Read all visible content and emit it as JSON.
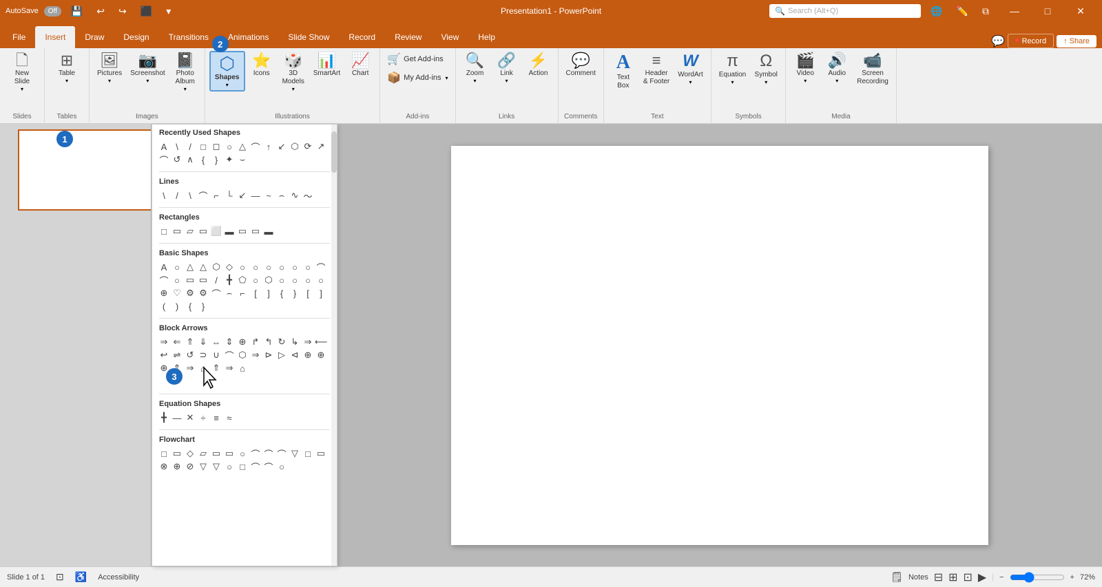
{
  "titleBar": {
    "autosave": "AutoSave",
    "toggleState": "Off",
    "title": "Presentation1 - PowerPoint",
    "searchPlaceholder": "Search (Alt+Q)"
  },
  "tabs": {
    "items": [
      "File",
      "Insert",
      "Draw",
      "Design",
      "Transitions",
      "Animations",
      "Slide Show",
      "Record",
      "Review",
      "View",
      "Help"
    ],
    "activeTab": "Insert"
  },
  "ribbonGroups": {
    "slides": {
      "label": "Slides",
      "items": [
        {
          "label": "New\nSlide",
          "icon": "🗋"
        }
      ]
    },
    "tables": {
      "label": "Tables",
      "items": [
        {
          "label": "Table",
          "icon": "⊞"
        }
      ]
    },
    "images": {
      "label": "Images",
      "items": [
        {
          "label": "Pictures",
          "icon": "🖼"
        },
        {
          "label": "Screenshot",
          "icon": "📷"
        },
        {
          "label": "Photo\nAlbum",
          "icon": "📓"
        }
      ]
    },
    "illustrations": {
      "label": "Illustrations",
      "items": [
        {
          "label": "Shapes",
          "icon": "⬡",
          "active": true
        },
        {
          "label": "Icons",
          "icon": "⭐"
        },
        {
          "label": "3D\nModels",
          "icon": "🎲"
        },
        {
          "label": "SmartArt",
          "icon": "📊"
        },
        {
          "label": "Chart",
          "icon": "📈"
        }
      ]
    },
    "addins": {
      "label": "Add-ins",
      "items": [
        {
          "label": "Get Add-ins",
          "icon": "🛒"
        },
        {
          "label": "My Add-ins",
          "icon": "📦"
        }
      ]
    },
    "links": {
      "label": "Links",
      "items": [
        {
          "label": "Zoom",
          "icon": "🔍"
        },
        {
          "label": "Link",
          "icon": "🔗"
        },
        {
          "label": "Action",
          "icon": "⚡"
        }
      ]
    },
    "comments": {
      "label": "Comments",
      "items": [
        {
          "label": "Comment",
          "icon": "💬"
        }
      ]
    },
    "text": {
      "label": "Text",
      "items": [
        {
          "label": "Text\nBox",
          "icon": "A"
        },
        {
          "label": "Header\n& Footer",
          "icon": "≡"
        },
        {
          "label": "WordArt",
          "icon": "W"
        }
      ]
    },
    "symbols": {
      "label": "Symbols",
      "items": [
        {
          "label": "Equation",
          "icon": "π"
        },
        {
          "label": "Symbol",
          "icon": "Ω"
        }
      ]
    },
    "media": {
      "label": "Media",
      "items": [
        {
          "label": "Video",
          "icon": "🎬"
        },
        {
          "label": "Audio",
          "icon": "🔊"
        },
        {
          "label": "Screen\nRecording",
          "icon": "📹"
        }
      ]
    }
  },
  "shapesPanel": {
    "sections": [
      {
        "title": "Recently Used Shapes",
        "shapes": [
          "A",
          "\\",
          "/",
          "□",
          "◻",
          "○",
          "△",
          "⌒",
          "⌒",
          "↑",
          "↙",
          "⬡",
          "⟳",
          "↺",
          "↗",
          "∧",
          "⌣",
          "{",
          "}",
          "✦"
        ]
      },
      {
        "title": "Lines",
        "shapes": [
          "\\",
          "/",
          "\\",
          "⌒",
          "⌐",
          "└",
          "↙",
          "—",
          "~",
          "⌒",
          "⌢",
          "∿",
          "~"
        ]
      },
      {
        "title": "Rectangles",
        "shapes": [
          "□",
          "▭",
          "▱",
          "▭",
          "⬜",
          "▬",
          "▭",
          "▭",
          "▬"
        ]
      },
      {
        "title": "Basic Shapes",
        "shapes": [
          "A",
          "○",
          "△",
          "△",
          "⬡",
          "◇",
          "○",
          "○",
          "○",
          "○",
          "○",
          "○",
          "○",
          "○",
          "⌒",
          "⌒",
          "○",
          "⌒",
          "▭",
          "⬜",
          "▭",
          "/",
          "╋",
          "⬠",
          "○",
          "⬡",
          "○",
          "○",
          "○",
          "○",
          "⊕",
          "♡",
          "⚙",
          "⚙",
          "⌒",
          "⌢",
          "⌐",
          "[",
          "]",
          "{",
          "}",
          "[",
          "]",
          "(",
          ")",
          "{",
          "}"
        ]
      },
      {
        "title": "Block Arrows",
        "shapes": [
          "⇒",
          "⇐",
          "⇑",
          "⇓",
          "⇔",
          "⇕",
          "⊕",
          "↱",
          "↰",
          "↻",
          "↳",
          "⇒",
          "⤷",
          "↩",
          "⇌",
          "↺",
          "⊃",
          "∪",
          "⌒",
          "⬡",
          "⇒",
          "⊳",
          "▷",
          "⊲",
          "⊕",
          "⊕",
          "⊕",
          "⇑",
          "⇒",
          "⌂"
        ]
      },
      {
        "title": "Equation Shapes",
        "shapes": [
          "╋",
          "—",
          "✕",
          "÷",
          "≡",
          "≈"
        ]
      },
      {
        "title": "Flowchart",
        "shapes": [
          "□",
          "▭",
          "◇",
          "▱",
          "▭",
          "▭",
          "○",
          "⌒",
          "⌒",
          "⌒",
          "▽",
          "□",
          "▭",
          "⊗",
          "⊕",
          "⊘",
          "▽",
          "▽",
          "○",
          "□",
          "⌒",
          "⌒",
          "○"
        ]
      }
    ]
  },
  "statusBar": {
    "slideInfo": "Slide 1 of 1",
    "accessibility": "Accessibility",
    "notes": "Notes",
    "zoom": "72%"
  },
  "badges": [
    {
      "number": "1",
      "description": "Insert tab indicator"
    },
    {
      "number": "2",
      "description": "Shapes button indicator"
    },
    {
      "number": "3",
      "description": "Block Arrows cursor indicator"
    }
  ],
  "buttons": {
    "record": "Record",
    "share": "Share"
  }
}
